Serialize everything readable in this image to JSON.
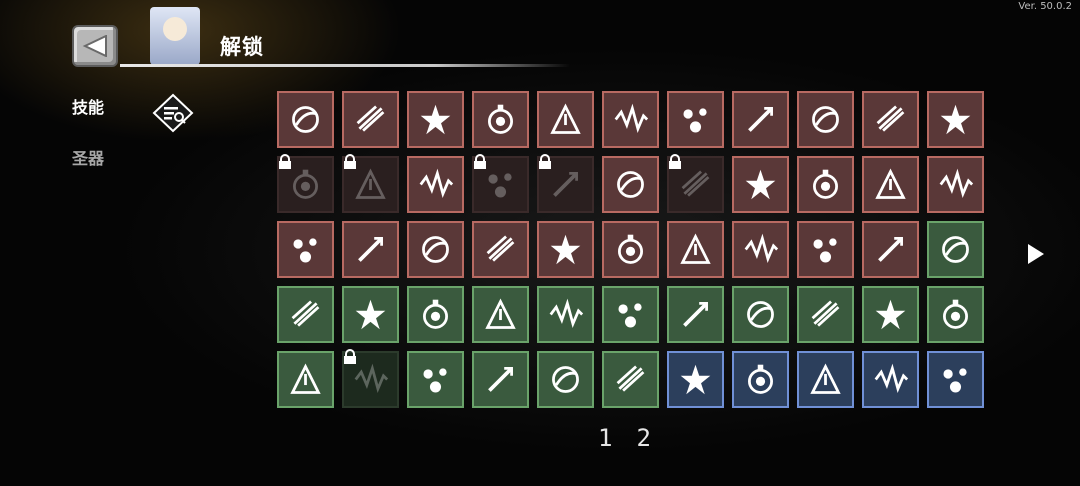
{
  "version": "Ver. 50.0.2",
  "header": {
    "title": "解锁"
  },
  "categories": [
    {
      "label": "技能",
      "active": true
    },
    {
      "label": "圣器",
      "active": false
    }
  ],
  "icons": {
    "back": "back-arrow-icon",
    "filter": "filter-search-icon",
    "lock": "lock-icon",
    "next": "next-page-arrow-icon"
  },
  "colors": {
    "red_tile": "#5a3838",
    "green_tile": "#3a5a3e",
    "blue_tile": "#2c3f5c"
  },
  "skills": [
    {
      "icon": "slash-orbit-icon",
      "tier": "red",
      "locked": false
    },
    {
      "icon": "crescent-blade-icon",
      "tier": "red",
      "locked": false
    },
    {
      "icon": "burst-shield-icon",
      "tier": "red",
      "locked": false
    },
    {
      "icon": "radial-burst-icon",
      "tier": "red",
      "locked": false
    },
    {
      "icon": "arrow-upgrade-icon",
      "tier": "red",
      "locked": false
    },
    {
      "icon": "gear-orb-icon",
      "tier": "red",
      "locked": false
    },
    {
      "icon": "potion-orb-icon",
      "tier": "red",
      "locked": false
    },
    {
      "icon": "thunder-ring-icon",
      "tier": "red",
      "locked": false
    },
    {
      "icon": "arrow-rain-icon",
      "tier": "red",
      "locked": false
    },
    {
      "icon": "biohazard-spikes-icon",
      "tier": "red",
      "locked": false
    },
    {
      "icon": "crescent-moon-icon",
      "tier": "red",
      "locked": false
    },
    {
      "icon": "wind-streak-icon",
      "tier": "red",
      "locked": true
    },
    {
      "icon": "feather-icon",
      "tier": "red",
      "locked": true
    },
    {
      "icon": "spark-cross-icon",
      "tier": "red",
      "locked": false
    },
    {
      "icon": "frost-sword-icon",
      "tier": "red",
      "locked": true
    },
    {
      "icon": "vortex-icon",
      "tier": "red",
      "locked": true
    },
    {
      "icon": "target-orb-icon",
      "tier": "red",
      "locked": false
    },
    {
      "icon": "leaf-dash-icon",
      "tier": "red",
      "locked": true
    },
    {
      "icon": "cloud-burst-icon",
      "tier": "red",
      "locked": false
    },
    {
      "icon": "fist-icon",
      "tier": "red",
      "locked": false
    },
    {
      "icon": "eye-arc-icon",
      "tier": "red",
      "locked": false
    },
    {
      "icon": "triple-slash-icon",
      "tier": "red",
      "locked": false
    },
    {
      "icon": "lightning-orb-icon",
      "tier": "red",
      "locked": false
    },
    {
      "icon": "claw-slash-icon",
      "tier": "red",
      "locked": false
    },
    {
      "icon": "spear-thrust-icon",
      "tier": "red",
      "locked": false
    },
    {
      "icon": "cross-slash-icon",
      "tier": "red",
      "locked": false
    },
    {
      "icon": "pulse-wave-icon",
      "tier": "red",
      "locked": false
    },
    {
      "icon": "fire-orb-icon",
      "tier": "red",
      "locked": false
    },
    {
      "icon": "ground-spikes-icon",
      "tier": "red",
      "locked": false
    },
    {
      "icon": "jaw-trap-icon",
      "tier": "red",
      "locked": false
    },
    {
      "icon": "ice-spikes-icon",
      "tier": "red",
      "locked": false
    },
    {
      "icon": "comet-streak-icon",
      "tier": "red",
      "locked": false
    },
    {
      "icon": "shockwave-icon",
      "tier": "green",
      "locked": false
    },
    {
      "icon": "chain-burst-icon",
      "tier": "green",
      "locked": false
    },
    {
      "icon": "lightning-bolt-icon",
      "tier": "green",
      "locked": false
    },
    {
      "icon": "turret-icon",
      "tier": "green",
      "locked": false
    },
    {
      "icon": "poison-cloud-icon",
      "tier": "green",
      "locked": false
    },
    {
      "icon": "skull-burst-icon",
      "tier": "green",
      "locked": false
    },
    {
      "icon": "biohazard-icon",
      "tier": "green",
      "locked": false
    },
    {
      "icon": "sword-icon",
      "tier": "green",
      "locked": false
    },
    {
      "icon": "flame-bottle-icon",
      "tier": "green",
      "locked": false
    },
    {
      "icon": "spin-shield-icon",
      "tier": "green",
      "locked": false
    },
    {
      "icon": "falling-swords-icon",
      "tier": "green",
      "locked": false
    },
    {
      "icon": "crack-icon",
      "tier": "green",
      "locked": false
    },
    {
      "icon": "sparkle-dust-icon",
      "tier": "green",
      "locked": false
    },
    {
      "icon": "claw-dash-icon",
      "tier": "green",
      "locked": true
    },
    {
      "icon": "shuriken-icon",
      "tier": "green",
      "locked": false
    },
    {
      "icon": "wind-slash-icon",
      "tier": "green",
      "locked": false
    },
    {
      "icon": "water-drop-icon",
      "tier": "green",
      "locked": false
    },
    {
      "icon": "gatling-icon",
      "tier": "green",
      "locked": false
    },
    {
      "icon": "soccer-ball-icon",
      "tier": "blue",
      "locked": false
    },
    {
      "icon": "blue-flame-icon",
      "tier": "blue",
      "locked": false
    },
    {
      "icon": "hourglass-up-icon",
      "tier": "blue",
      "locked": false
    },
    {
      "icon": "stat-up-icon",
      "tier": "blue",
      "locked": false
    },
    {
      "icon": "chart-up-icon",
      "tier": "blue",
      "locked": false
    }
  ],
  "pagination": {
    "pages": [
      "1",
      "2"
    ]
  }
}
